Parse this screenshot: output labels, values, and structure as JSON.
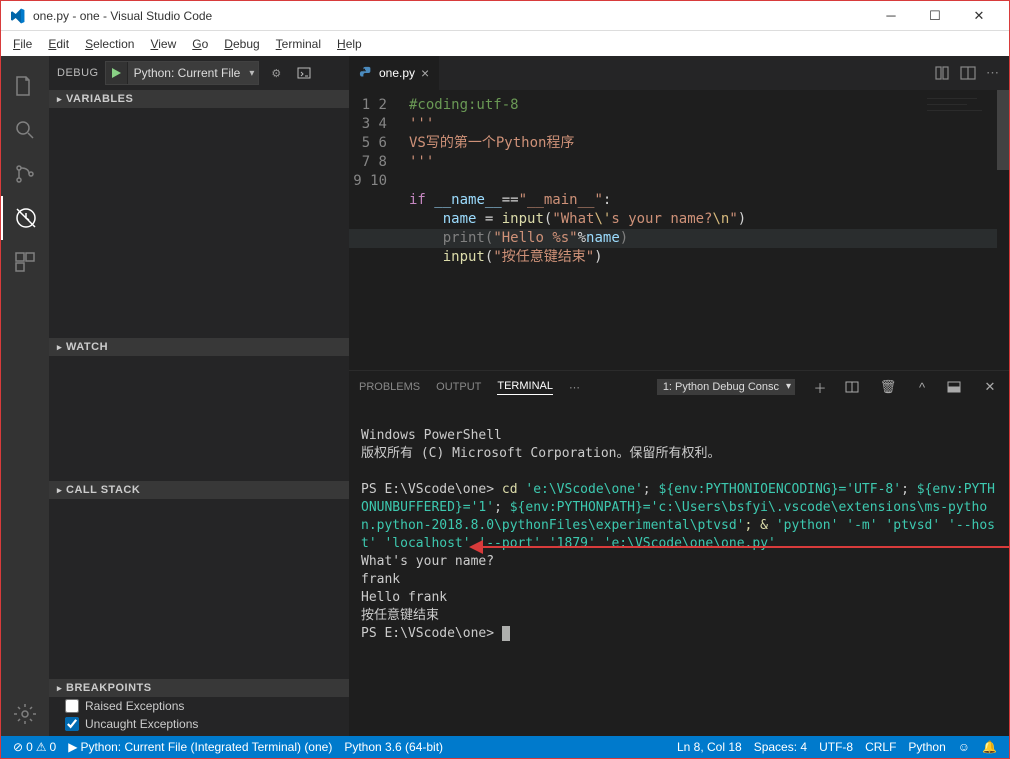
{
  "window": {
    "title": "one.py - one - Visual Studio Code"
  },
  "menu": {
    "file": "File",
    "edit": "Edit",
    "selection": "Selection",
    "view": "View",
    "go": "Go",
    "debug": "Debug",
    "terminal": "Terminal",
    "help": "Help"
  },
  "debug": {
    "label": "DEBUG",
    "config": "Python: Current File",
    "sections": {
      "variables": "VARIABLES",
      "watch": "WATCH",
      "callstack": "CALL STACK",
      "breakpoints": "BREAKPOINTS"
    },
    "breakpoints": {
      "raised": "Raised Exceptions",
      "uncaught": "Uncaught Exceptions"
    }
  },
  "tab": {
    "filename": "one.py"
  },
  "editor": {
    "lines": [
      "1",
      "2",
      "3",
      "4",
      "5",
      "6",
      "7",
      "8",
      "9",
      "10"
    ],
    "l1": "#coding:utf-8",
    "l2": "'''",
    "l3": "VS写的第一个Python程序",
    "l4": "'''",
    "l6_if": "if",
    "l6_name": "__name__",
    "l6_eq": "==",
    "l6_main": "\"__main__\"",
    "l6_colon": ":",
    "l7_var": "name",
    "l7_eq": " = ",
    "l7_fn": "input",
    "l7_str": "\"What",
    "l7_esc": "\\'",
    "l7_str2": "s your name?",
    "l7_esc2": "\\n",
    "l7_end": "\"",
    "l8_fn": "print",
    "l8_str": "\"Hello %s\"",
    "l8_pct": "%",
    "l8_var": "name",
    "l9_fn": "input",
    "l9_str": "\"按任意键结束\""
  },
  "panel": {
    "tabs": {
      "problems": "PROBLEMS",
      "output": "OUTPUT",
      "terminal": "TERMINAL"
    },
    "selector": "1: Python Debug Consc"
  },
  "terminal": {
    "l1": "Windows PowerShell",
    "l2": "版权所有 (C) Microsoft Corporation。保留所有权利。",
    "ps1": "PS E:\\VScode\\one>",
    "cmd": " cd ",
    "path1": "'e:\\VScode\\one'",
    "sep": "; ",
    "env1a": "${env:PYTHONIOENCODING}=",
    "env1b": "'UTF-8'",
    "env2a": "${env:PYTHONUNBUFFERED}=",
    "env2b": "'1'",
    "env3a": "${env:PYTHONPATH}=",
    "env3b": "'c:\\Users\\bsfyi\\.vscode\\extensions\\ms-python.python-2018.8.0\\pythonFiles\\experimental\\ptvsd'",
    "amp": "; & ",
    "py": "'python'",
    "m": " '-m' ",
    "ptvsd": "'ptvsd'",
    "host": " '--host' ",
    "localhost": "'localhost'",
    "port": " '--port' ",
    "portnum": "'1879'",
    "file": " 'e:\\VScode\\one\\one.py'",
    "q": "What's your name?",
    "ans": "frank",
    "hello": "Hello frank",
    "end": "按任意键结束",
    "ps2": "PS E:\\VScode\\one>"
  },
  "status": {
    "errors": "0",
    "warnings": "0",
    "launch": "Python: Current File (Integrated Terminal) (one)",
    "python": "Python 3.6 (64-bit)",
    "pos": "Ln 8, Col 18",
    "spaces": "Spaces: 4",
    "encoding": "UTF-8",
    "eol": "CRLF",
    "lang": "Python"
  }
}
